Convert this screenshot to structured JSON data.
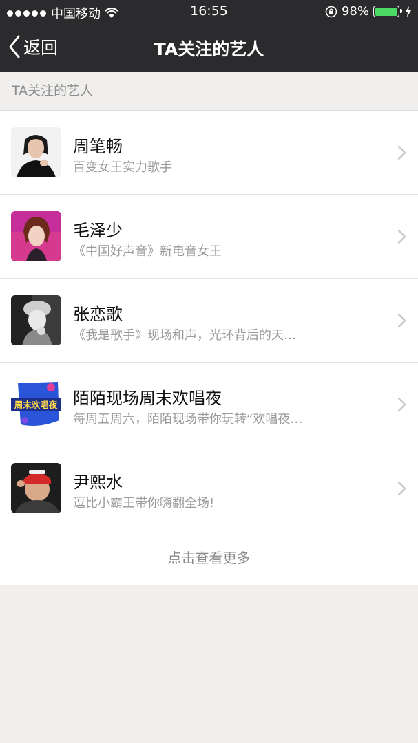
{
  "status_bar": {
    "carrier": "中国移动",
    "time": "16:55",
    "battery_percent": "98%",
    "battery_level": 0.98,
    "battery_color": "#4cd964"
  },
  "nav": {
    "back_label": "返回",
    "title": "TA关注的艺人"
  },
  "section": {
    "header": "TA关注的艺人"
  },
  "artists": [
    {
      "name": "周笔畅",
      "desc": "百变女王实力歌手",
      "avatar": "portrait-woman-dark-icon"
    },
    {
      "name": "毛泽少",
      "desc": "《中国好声音》新电音女王",
      "avatar": "portrait-woman-pink-icon"
    },
    {
      "name": "张恋歌",
      "desc": "《我是歌手》现场和声，光环背后的天…",
      "avatar": "portrait-woman-bw-icon"
    },
    {
      "name": "陌陌现场周末欢唱夜",
      "desc": "每周五周六，陌陌现场带你玩转“欢唱夜…",
      "avatar": "event-logo-icon",
      "avatar_text": "周末欢唱夜"
    },
    {
      "name": "尹熙水",
      "desc": "逗比小霸王带你嗨翻全场!",
      "avatar": "portrait-man-red-cap-icon"
    }
  ],
  "more": {
    "label": "点击查看更多"
  },
  "colors": {
    "nav_bg": "#2b2b2d",
    "page_bg": "#f0efed"
  }
}
